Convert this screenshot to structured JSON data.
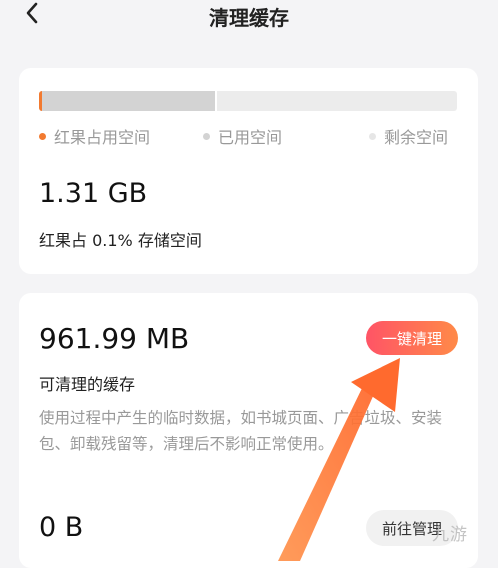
{
  "header": {
    "back_icon": "chevron-left-icon",
    "title": "清理缓存"
  },
  "storage": {
    "app_fraction": 0.001,
    "used_fraction": 0.42,
    "legend": {
      "app": "红果占用空间",
      "used": "已用空间",
      "free": "剩余空间"
    },
    "total_size": "1.31 GB",
    "total_desc": "红果占 0.1% 存储空间"
  },
  "cache": {
    "size": "961.99 MB",
    "label": "可清理的缓存",
    "description": "使用过程中产生的临时数据，如书城页面、广告垃圾、安装包、卸载残留等，清理后不影响正常使用。",
    "clean_button": "一键清理"
  },
  "other": {
    "size": "0 B",
    "manage_button": "前往管理"
  },
  "colors": {
    "app_segment": "#f27a30",
    "used_segment": "#d3d3d3",
    "free_segment": "#ececec",
    "clean_gradient_start": "#ff5466",
    "clean_gradient_end": "#ff8a48",
    "arrow": "#ff7a3c"
  },
  "watermark": "九游"
}
